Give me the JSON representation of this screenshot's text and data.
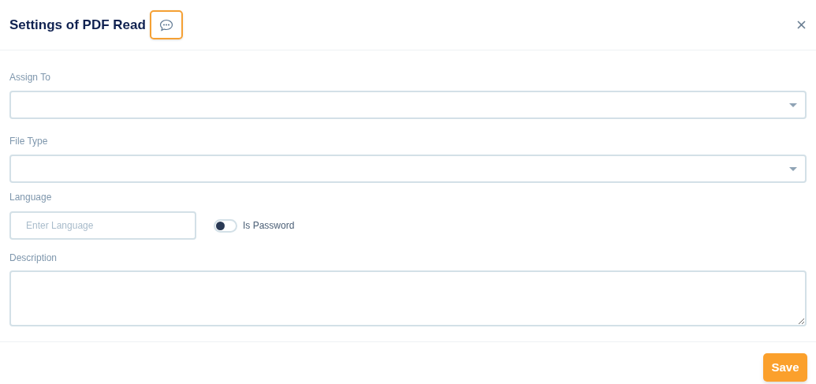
{
  "dialog": {
    "title": "Settings of PDF Read"
  },
  "fields": [
    {
      "kind": "select",
      "label": "Assign To"
    },
    {
      "kind": "select",
      "label": "File Type"
    }
  ],
  "language": {
    "label": "Language",
    "placeholder": "Enter Language"
  },
  "password_toggle": {
    "label": "Is Password",
    "on": false
  },
  "description": {
    "label": "Description"
  },
  "buttons": {
    "save": "Save"
  }
}
